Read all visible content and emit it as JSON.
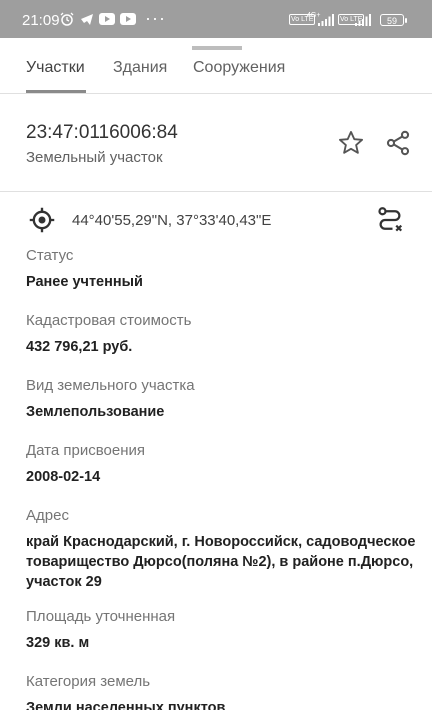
{
  "status_bar": {
    "time": "21:09",
    "network1": "4G+",
    "network2": "Vo LTE",
    "battery": "59",
    "more": "···"
  },
  "tabs": [
    {
      "label": "Участки",
      "active": true
    },
    {
      "label": "Здания",
      "active": false
    },
    {
      "label": "Сооружения",
      "active": false
    }
  ],
  "object": {
    "cadastral_number": "23:47:0116006:84",
    "type": "Земельный участок"
  },
  "coordinates": "44°40'55,29\"N, 37°33'40,43\"E",
  "fields": [
    {
      "label": "Статус",
      "value": "Ранее учтенный"
    },
    {
      "label": "Кадастровая стоимость",
      "value": "432 796,21 руб."
    },
    {
      "label": "Вид земельного участка",
      "value": "Землепользование"
    },
    {
      "label": "Дата присвоения",
      "value": "2008-02-14"
    },
    {
      "label": "Адрес",
      "value": "край Краснодарский, г. Новороссийск, садоводческое товарищество Дюрсо(поляна №2), в районе п.Дюрсо, участок 29"
    },
    {
      "label": "Площадь уточненная",
      "value": "329 кв. м"
    },
    {
      "label": "Категория земель",
      "value": "Земли населенных пунктов"
    }
  ],
  "colors": {
    "accent": "#616161",
    "status_bar": "#9e9e9e",
    "divider": "#e0e0e0"
  }
}
